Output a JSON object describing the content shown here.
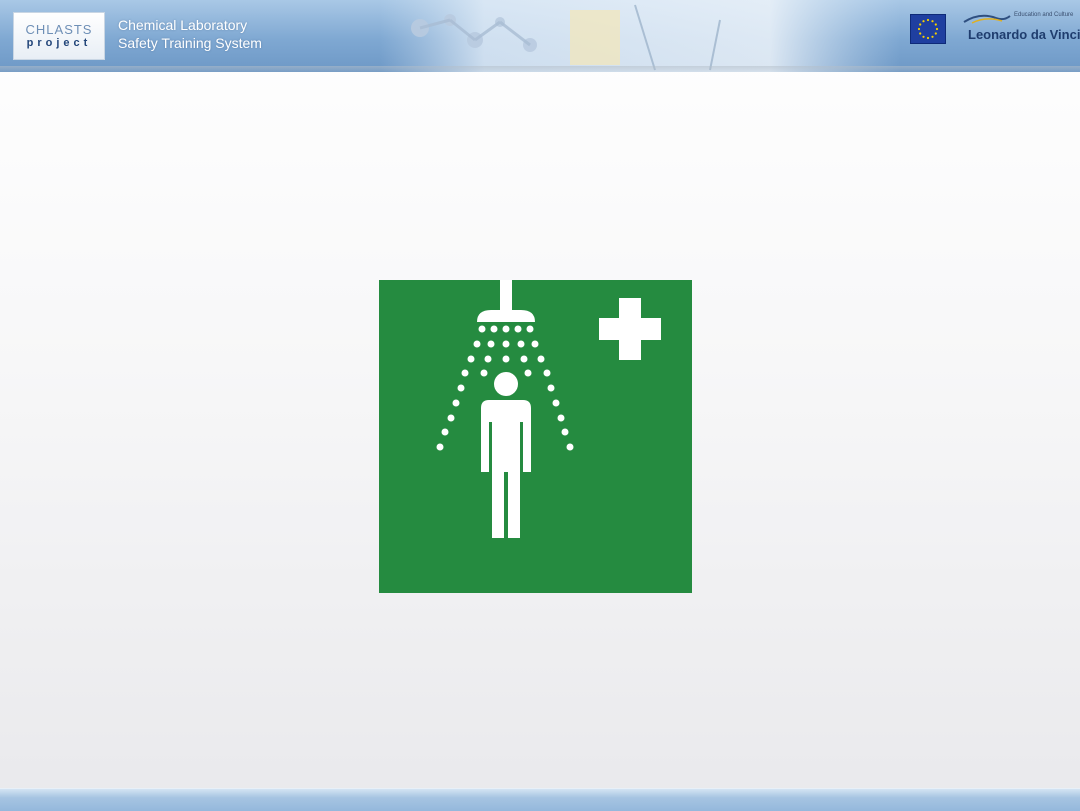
{
  "header": {
    "logo": {
      "name": "CHLASTS",
      "sub": "project"
    },
    "title_line1": "Chemical Laboratory",
    "title_line2": "Safety Training System",
    "partner": {
      "tagline": "Education and Culture",
      "name": "Leonardo da Vinci"
    },
    "eu_flag_icon": "eu-flag-icon"
  },
  "main": {
    "sign_icon": "emergency-safety-shower-icon",
    "sign_color": "#258b40",
    "symbol_color": "#ffffff"
  },
  "colors": {
    "header_blue": "#7fa8d2",
    "footer_blue": "#a6c4e2",
    "flag_blue": "#1f3fa0",
    "flag_star": "#f5d000"
  }
}
